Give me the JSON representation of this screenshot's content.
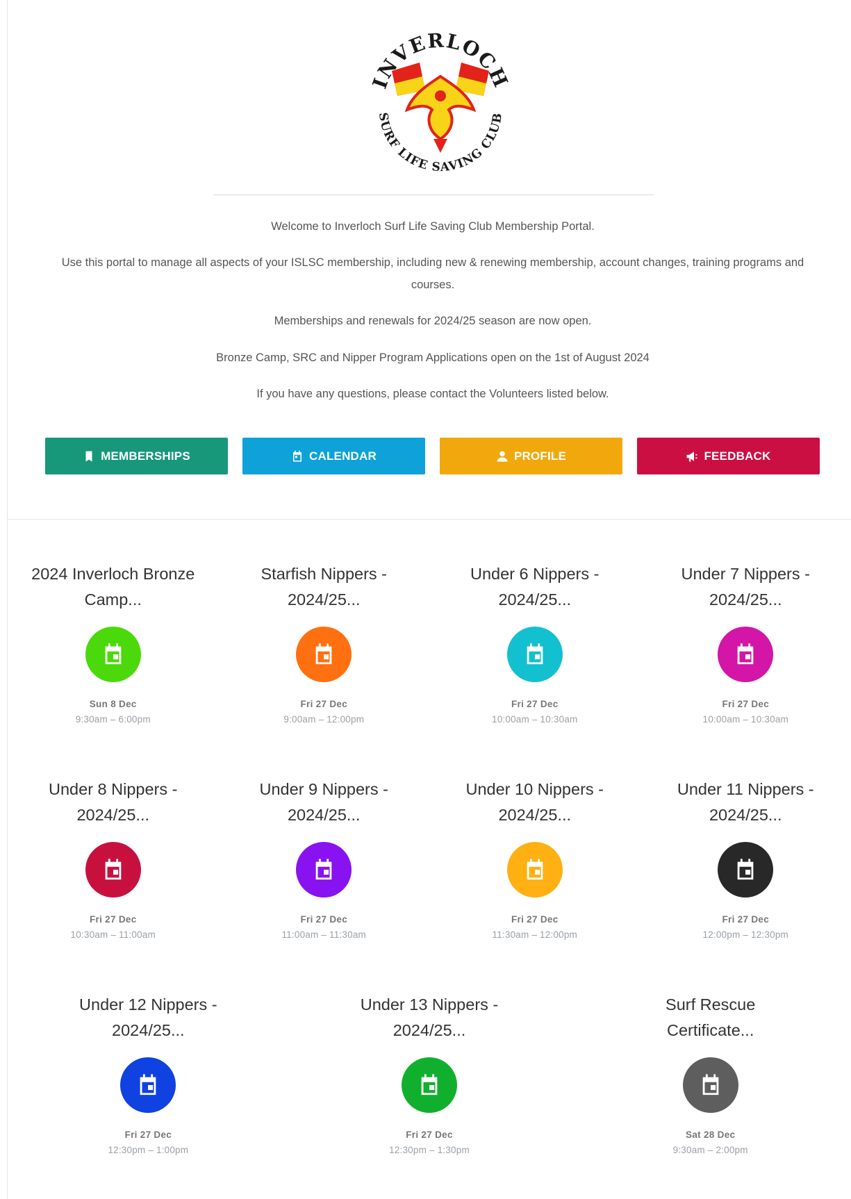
{
  "logo": {
    "top_text": "INVERLOCH",
    "bottom_text": "SURF LIFE SAVING CLUB",
    "colors": {
      "red": "#e2231a",
      "yellow": "#f7d417",
      "black": "#1a1a1a"
    }
  },
  "intro": {
    "p1": "Welcome to Inverloch Surf Life Saving Club Membership Portal.",
    "p2": "Use this portal to manage all aspects of your ISLSC membership, including new & renewing membership, account changes, training programs and courses.",
    "p3": "Memberships and renewals for 2024/25 season are now open.",
    "p4": "Bronze Camp, SRC and Nipper Program Applications open on the 1st of August 2024",
    "p5": "If you have any questions, please contact the Volunteers listed below."
  },
  "buttons": [
    {
      "label": "MEMBERSHIPS",
      "icon": "bookmark-icon",
      "color": "#17987a"
    },
    {
      "label": "CALENDAR",
      "icon": "calendar-icon",
      "color": "#0ea2d9"
    },
    {
      "label": "PROFILE",
      "icon": "person-icon",
      "color": "#f0a80d"
    },
    {
      "label": "FEEDBACK",
      "icon": "megaphone-icon",
      "color": "#cc0f42"
    }
  ],
  "events": [
    {
      "title": "2024 Inverloch Bronze Camp...",
      "date": "Sun 8 Dec",
      "time": "9:30am – 6:00pm",
      "color": "#4cd90b"
    },
    {
      "title": "Starfish Nippers - 2024/25...",
      "date": "Fri 27 Dec",
      "time": "9:00am – 12:00pm",
      "color": "#ff7010"
    },
    {
      "title": "Under 6 Nippers - 2024/25...",
      "date": "Fri 27 Dec",
      "time": "10:00am – 10:30am",
      "color": "#13c0d0"
    },
    {
      "title": "Under 7 Nippers - 2024/25...",
      "date": "Fri 27 Dec",
      "time": "10:00am – 10:30am",
      "color": "#d315a8"
    },
    {
      "title": "Under 8 Nippers - 2024/25...",
      "date": "Fri 27 Dec",
      "time": "10:30am – 11:00am",
      "color": "#c8103e"
    },
    {
      "title": "Under 9 Nippers - 2024/25...",
      "date": "Fri 27 Dec",
      "time": "11:00am – 11:30am",
      "color": "#8812f0"
    },
    {
      "title": "Under 10 Nippers - 2024/25...",
      "date": "Fri 27 Dec",
      "time": "11:30am – 12:00pm",
      "color": "#ffb012"
    },
    {
      "title": "Under 11 Nippers - 2024/25...",
      "date": "Fri 27 Dec",
      "time": "12:00pm – 12:30pm",
      "color": "#282828"
    },
    {
      "title": "Under 12 Nippers - 2024/25...",
      "date": "Fri 27 Dec",
      "time": "12:30pm – 1:00pm",
      "color": "#0f42e0"
    },
    {
      "title": "Under 13 Nippers - 2024/25...",
      "date": "Fri 27 Dec",
      "time": "12:30pm – 1:30pm",
      "color": "#10b02e"
    },
    {
      "title": "Surf Rescue Certificate...",
      "date": "Sat 28 Dec",
      "time": "9:30am – 2:00pm",
      "color": "#5e5e5e"
    }
  ]
}
